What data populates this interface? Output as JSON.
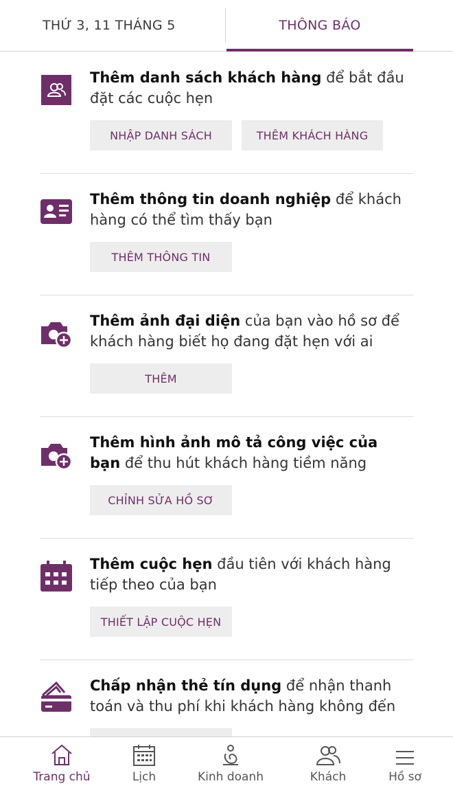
{
  "header": {
    "date_tab": "THỨ 3, 11 THÁNG 5",
    "notifications_tab": "THÔNG BÁO"
  },
  "cards": [
    {
      "title": "Thêm danh sách khách hàng",
      "body": " để bắt đầu đặt các cuộc hẹn",
      "icon": "clients-icon",
      "buttons": [
        "NHẬP DANH SÁCH",
        "THÊM KHÁCH HÀNG"
      ]
    },
    {
      "title": "Thêm thông tin doanh nghiệp",
      "body": " để khách hàng có thể tìm thấy bạn",
      "icon": "business-card-icon",
      "buttons": [
        "THÊM THÔNG TIN"
      ]
    },
    {
      "title": "Thêm ảnh đại diện",
      "body": " của bạn vào hồ sơ để khách hàng biết họ đang đặt hẹn với ai",
      "icon": "add-photo-icon",
      "buttons": [
        "THÊM"
      ]
    },
    {
      "title": "Thêm hình ảnh mô tả công việc của bạn",
      "body": " để thu hút khách hàng tiềm năng",
      "icon": "add-photo-icon",
      "buttons": [
        "CHỈNH SỬA HỒ SƠ"
      ]
    },
    {
      "title": "Thêm cuộc hẹn",
      "body": " đầu tiên với khách hàng tiếp theo của bạn",
      "icon": "calendar-icon",
      "buttons": [
        "THIẾT LẬP CUỘC HẸN"
      ]
    },
    {
      "title": "Chấp nhận thẻ tín dụng",
      "body": " để nhận thanh toán và thu phí khi khách hàng không đến",
      "icon": "credit-card-icon",
      "buttons": [
        ""
      ]
    }
  ],
  "nav": [
    {
      "label": "Trang chủ",
      "icon": "home-icon",
      "active": true
    },
    {
      "label": "Lịch",
      "icon": "calendar-icon",
      "active": false
    },
    {
      "label": "Kinh doanh",
      "icon": "business-icon",
      "active": false
    },
    {
      "label": "Khách",
      "icon": "clients-icon",
      "active": false
    },
    {
      "label": "Hồ sơ",
      "icon": "menu-icon",
      "active": false
    }
  ],
  "colors": {
    "accent": "#6e2f68",
    "button_bg": "#eeeded",
    "divider": "#dddddd"
  }
}
